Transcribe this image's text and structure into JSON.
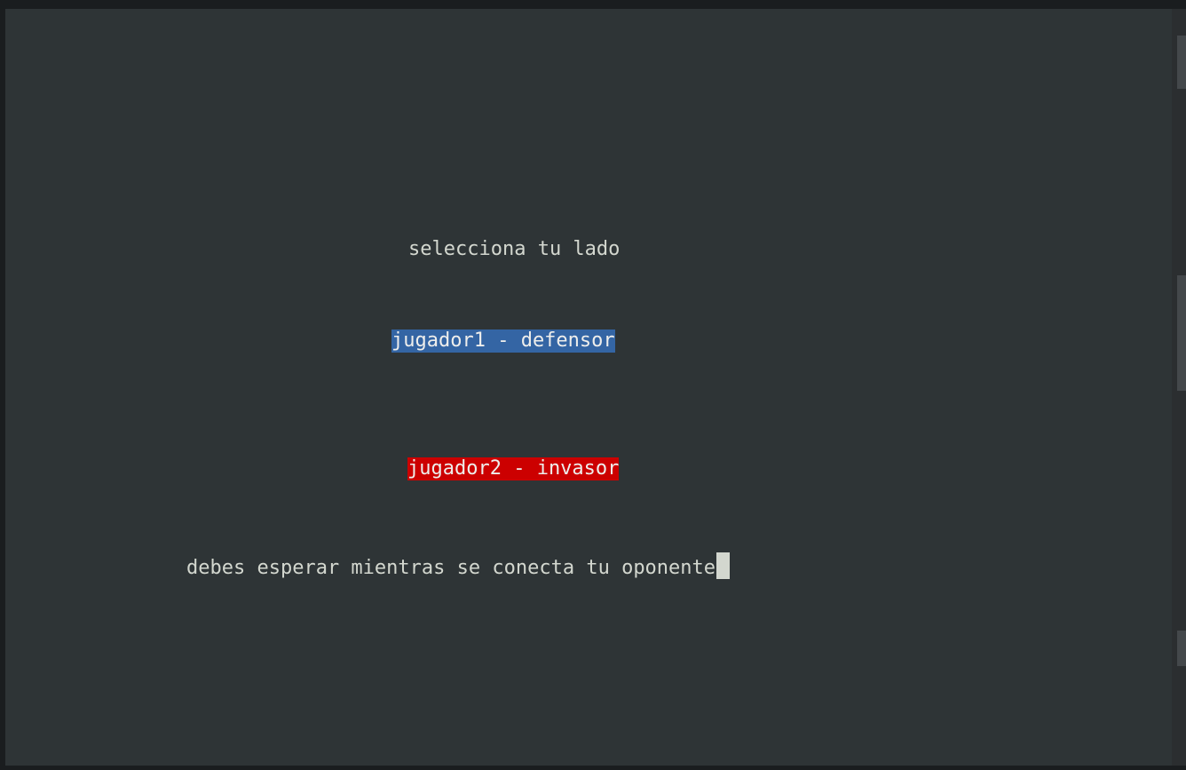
{
  "terminal": {
    "title_text": "selecciona tu lado",
    "option_defender": "jugador1 - defensor",
    "option_invader": "jugador2 - invasor",
    "waiting_message": "debes esperar mientras se conecta tu oponente"
  },
  "colors": {
    "background": "#2e3436",
    "text": "#d3d7cf",
    "defender_highlight": "#3465a4",
    "invader_highlight": "#cc0000"
  }
}
